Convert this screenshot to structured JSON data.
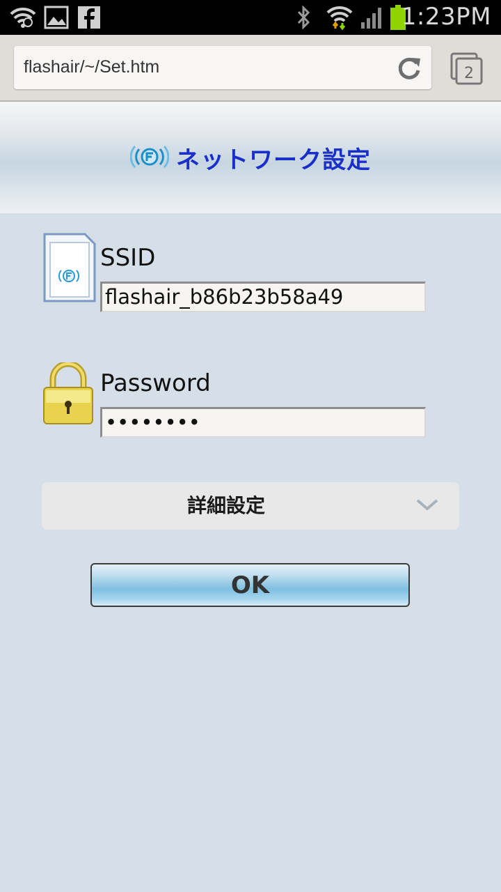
{
  "status_bar": {
    "time": "1:23PM",
    "icons": [
      "wifi-sync-icon",
      "gallery-icon",
      "facebook-icon",
      "bluetooth-icon",
      "wifi-icon",
      "signal-icon",
      "battery-icon"
    ],
    "battery_color": "#8fd400"
  },
  "browser": {
    "url": "flashair/~/Set.htm",
    "tab_count": "2"
  },
  "page": {
    "title": "ネットワーク設定",
    "title_color": "#1a2fc8",
    "ssid": {
      "label": "SSID",
      "value": "flashair_b86b23b58a49"
    },
    "password": {
      "label": "Password",
      "value": "••••••••"
    },
    "advanced_label": "詳細設定",
    "ok_label": "OK"
  }
}
